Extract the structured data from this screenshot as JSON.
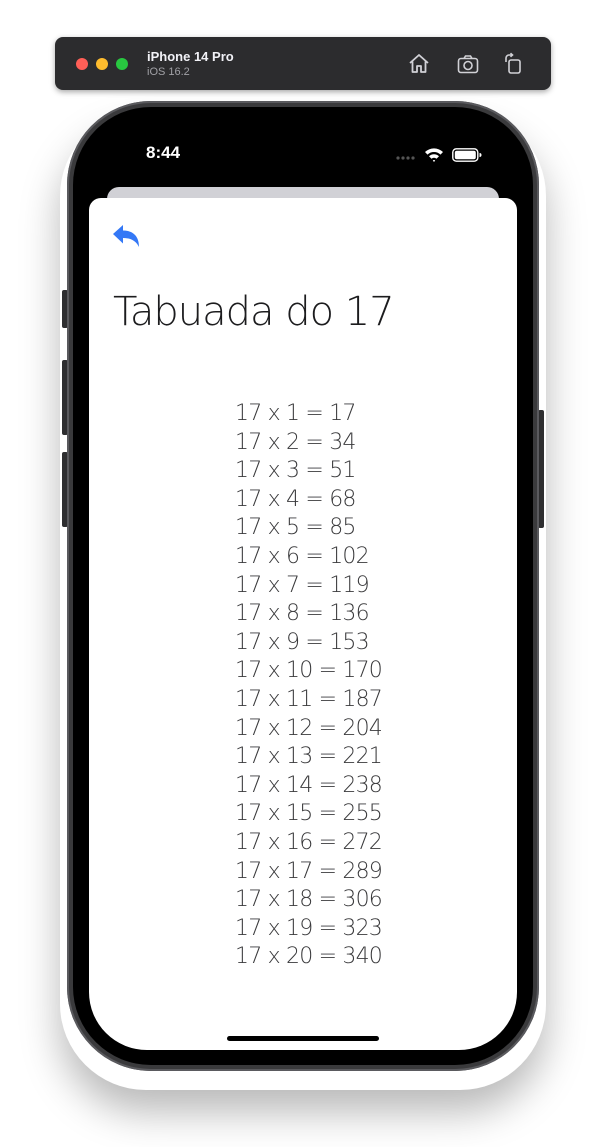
{
  "simulator": {
    "device_name": "iPhone 14 Pro",
    "os_version": "iOS 16.2"
  },
  "status_bar": {
    "time": "8:44"
  },
  "screen": {
    "title": "Tabuada do 17",
    "back_icon": "back-arrow-icon",
    "accent_color": "#3478f6",
    "rows": [
      "17 x 1 = 17",
      "17 x 2 = 34",
      "17 x 3 = 51",
      "17 x 4 = 68",
      "17 x 5 = 85",
      "17 x 6 = 102",
      "17 x 7 = 119",
      "17 x 8 = 136",
      "17 x 9 = 153",
      "17 x 10 = 170",
      "17 x 11 = 187",
      "17 x 12 = 204",
      "17 x 13 = 221",
      "17 x 14 = 238",
      "17 x 15 = 255",
      "17 x 16 = 272",
      "17 x 17 = 289",
      "17 x 18 = 306",
      "17 x 19 = 323",
      "17 x 20 = 340"
    ]
  }
}
